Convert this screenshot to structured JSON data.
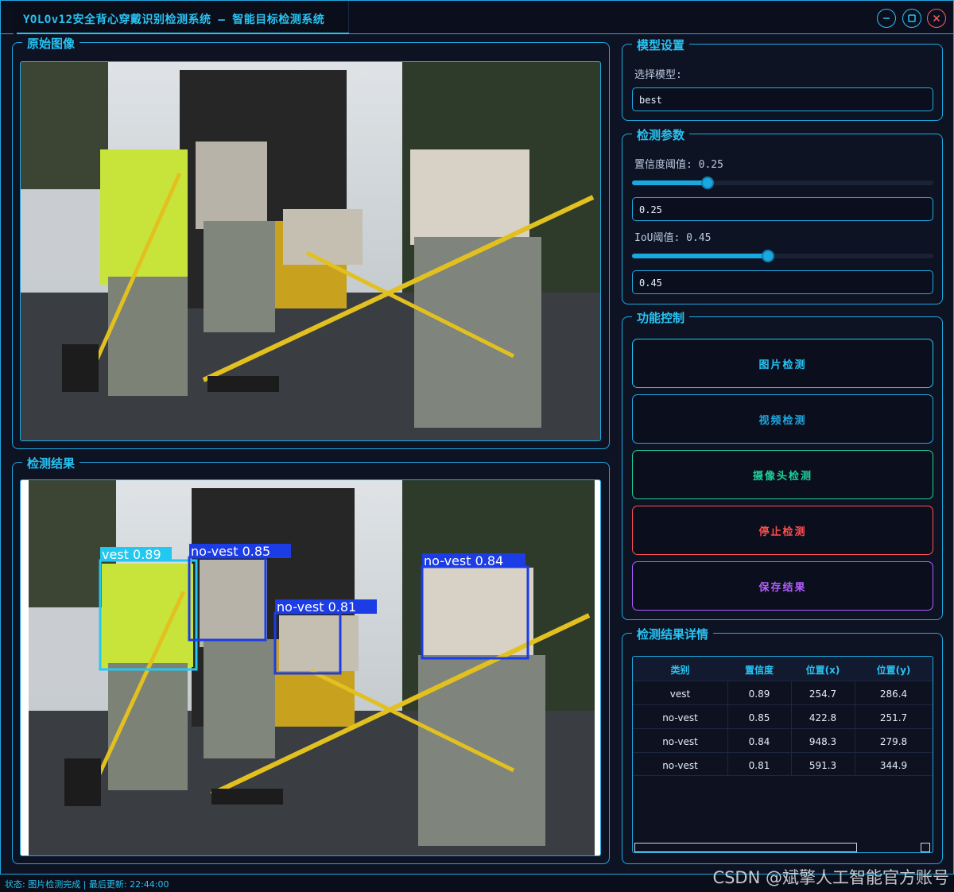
{
  "window": {
    "title": "YOLOv12安全背心穿戴识别检测系统 – 智能目标检测系统"
  },
  "panels": {
    "original": {
      "title": "原始图像"
    },
    "result": {
      "title": "检测结果"
    },
    "model": {
      "title": "模型设置",
      "select_label": "选择模型:",
      "model_value": "best"
    },
    "params": {
      "title": "检测参数",
      "conf_label": "置信度阈值: 0.25",
      "conf_value": "0.25",
      "conf_level": 0.25,
      "iou_label": "IoU阈值: 0.45",
      "iou_value": "0.45",
      "iou_level": 0.45
    },
    "controls": {
      "title": "功能控制",
      "image_btn": "图片检测",
      "video_btn": "视频检测",
      "camera_btn": "摄像头检测",
      "stop_btn": "停止检测",
      "save_btn": "保存结果"
    },
    "details": {
      "title": "检测结果详情",
      "columns": [
        "类别",
        "置信度",
        "位置(x)",
        "位置(y)"
      ],
      "rows": [
        [
          "vest",
          "0.89",
          "254.7",
          "286.4"
        ],
        [
          "no-vest",
          "0.85",
          "422.8",
          "251.7"
        ],
        [
          "no-vest",
          "0.84",
          "948.3",
          "279.8"
        ],
        [
          "no-vest",
          "0.81",
          "591.3",
          "344.9"
        ]
      ]
    }
  },
  "detections": [
    {
      "label": "vest 0.89",
      "color": "#22c8f0"
    },
    {
      "label": "no-vest 0.85",
      "color": "#1c3ce6"
    },
    {
      "label": "no-vest 0.81",
      "color": "#1c3ce6"
    },
    {
      "label": "no-vest 0.84",
      "color": "#1c3ce6"
    }
  ],
  "colors": {
    "accent": "#27c3f3",
    "image_btn": "#27c3f3",
    "video_btn": "#1fa8e0",
    "camera_btn": "#1fd09a",
    "stop_btn": "#ff4d4d",
    "save_btn": "#b15cff"
  },
  "status": "状态: 图片检测完成 | 最后更新: 22:44:00",
  "watermark": "CSDN @斌擎人工智能官方账号"
}
